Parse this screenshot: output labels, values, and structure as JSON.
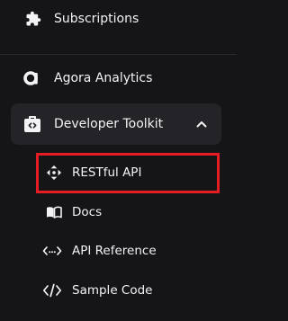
{
  "nav": {
    "items": [
      {
        "label": "Subscriptions",
        "icon": "puzzle-icon"
      },
      {
        "label": "Agora Analytics",
        "icon": "agora-logo-icon"
      },
      {
        "label": "Developer Toolkit",
        "icon": "toolkit-bag-icon",
        "expanded": true
      }
    ],
    "sub_items": [
      {
        "label": "RESTful API",
        "icon": "move-arrows-icon",
        "highlighted": true
      },
      {
        "label": "Docs",
        "icon": "book-icon"
      },
      {
        "label": "API Reference",
        "icon": "code-dots-icon"
      },
      {
        "label": "Sample Code",
        "icon": "code-brackets-icon"
      }
    ]
  },
  "colors": {
    "background": "#151517",
    "active_group": "#242428",
    "highlight_border": "#e51c23",
    "text": "#f3f3f5"
  }
}
